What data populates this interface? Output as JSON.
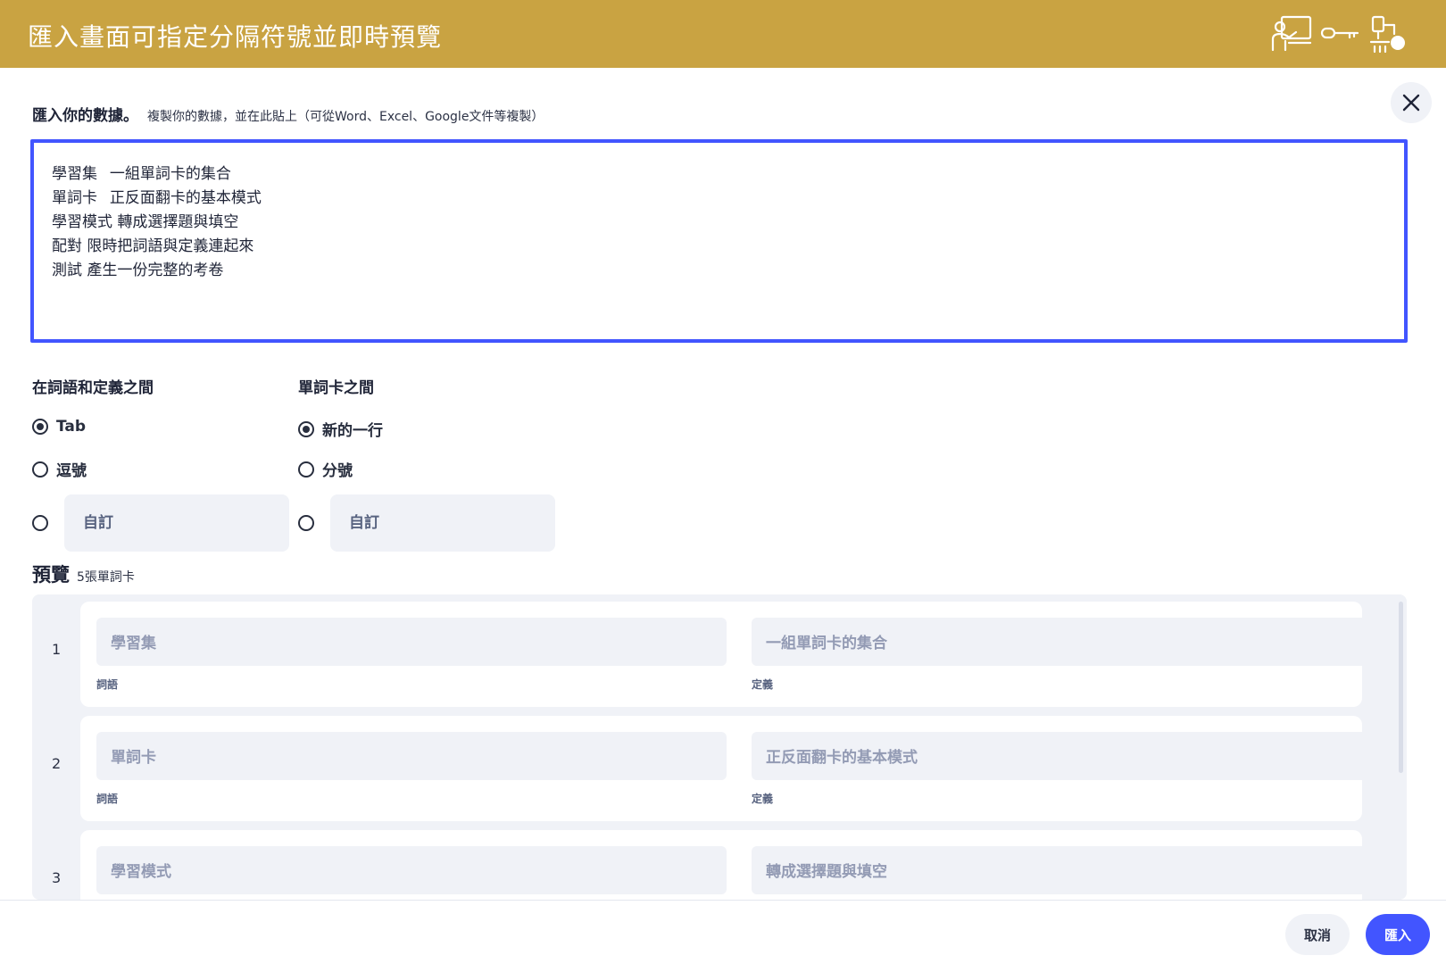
{
  "banner": {
    "title": "匯入畫面可指定分隔符號並即時預覽",
    "color": "#c9a342",
    "decor_icons": [
      "teacher-at-board-icon",
      "key-icon",
      "microscope-icon"
    ]
  },
  "close": {
    "icon": "close-icon"
  },
  "import": {
    "title": "匯入你的數據。",
    "hint": "複製你的數據，並在此貼上（可從Word、Excel、Google文件等複製）",
    "text": "學習集\t一組單詞卡的集合\n單詞卡\t正反面翻卡的基本模式\n學習模式 轉成選擇題與填空\n配對 限時把詞語與定義連起來\n測試 產生一份完整的考卷",
    "border_color": "#4255ff"
  },
  "term_separator": {
    "title": "在詞語和定義之間",
    "options": [
      {
        "label": "Tab",
        "checked": true
      },
      {
        "label": "逗號",
        "checked": false
      }
    ],
    "custom_placeholder": "自訂"
  },
  "card_separator": {
    "title": "單詞卡之間",
    "options": [
      {
        "label": "新的一行",
        "checked": true
      },
      {
        "label": "分號",
        "checked": false
      }
    ],
    "custom_placeholder": "自訂"
  },
  "preview": {
    "title": "預覽",
    "count": "5張單詞卡",
    "term_label": "詞語",
    "def_label": "定義",
    "cards": [
      {
        "num": "1",
        "term": "學習集",
        "definition": "一組單詞卡的集合"
      },
      {
        "num": "2",
        "term": "單詞卡",
        "definition": "正反面翻卡的基本模式"
      },
      {
        "num": "3",
        "term": "學習模式",
        "definition": "轉成選擇題與填空"
      }
    ]
  },
  "footer": {
    "cancel_label": "取消",
    "import_label": "匯入",
    "accent": "#4255ff"
  }
}
